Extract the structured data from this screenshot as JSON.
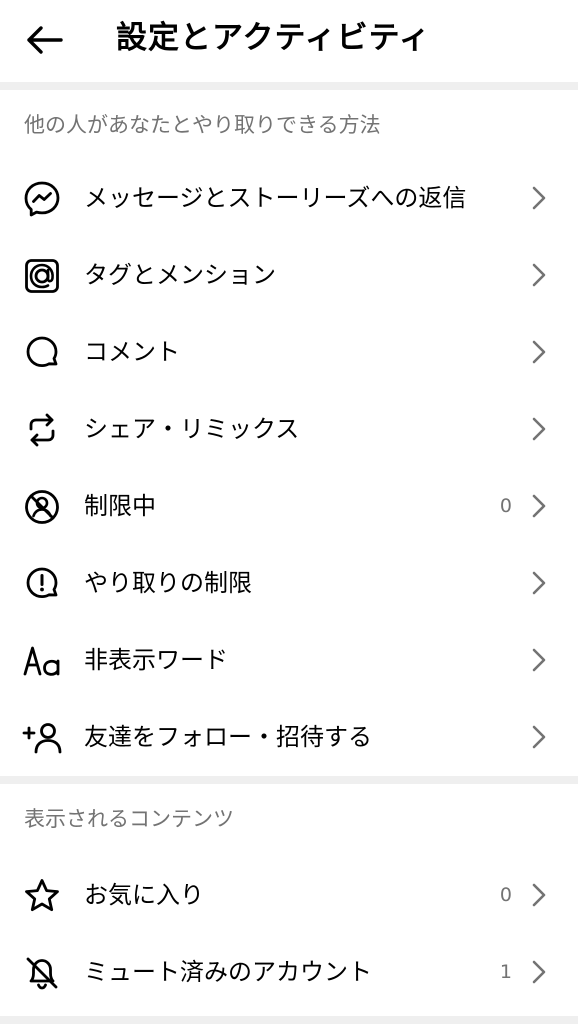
{
  "header": {
    "title": "設定とアクティビティ"
  },
  "sections": [
    {
      "label": "他の人があなたとやり取りできる方法",
      "items": [
        {
          "label": "メッセージとストーリーズへの返信",
          "icon": "messenger-icon",
          "count": ""
        },
        {
          "label": "タグとメンション",
          "icon": "at-sign-icon",
          "count": ""
        },
        {
          "label": "コメント",
          "icon": "comment-bubble-icon",
          "count": ""
        },
        {
          "label": "シェア・リミックス",
          "icon": "repost-icon",
          "count": ""
        },
        {
          "label": "制限中",
          "icon": "restricted-icon",
          "count": "0"
        },
        {
          "label": "やり取りの制限",
          "icon": "alert-bubble-icon",
          "count": ""
        },
        {
          "label": "非表示ワード",
          "icon": "text-aa-icon",
          "count": ""
        },
        {
          "label": "友達をフォロー・招待する",
          "icon": "add-person-icon",
          "count": ""
        }
      ]
    },
    {
      "label": "表示されるコンテンツ",
      "items": [
        {
          "label": "お気に入り",
          "icon": "star-icon",
          "count": "0"
        },
        {
          "label": "ミュート済みのアカウント",
          "icon": "muted-bell-icon",
          "count": "1"
        }
      ]
    }
  ]
}
